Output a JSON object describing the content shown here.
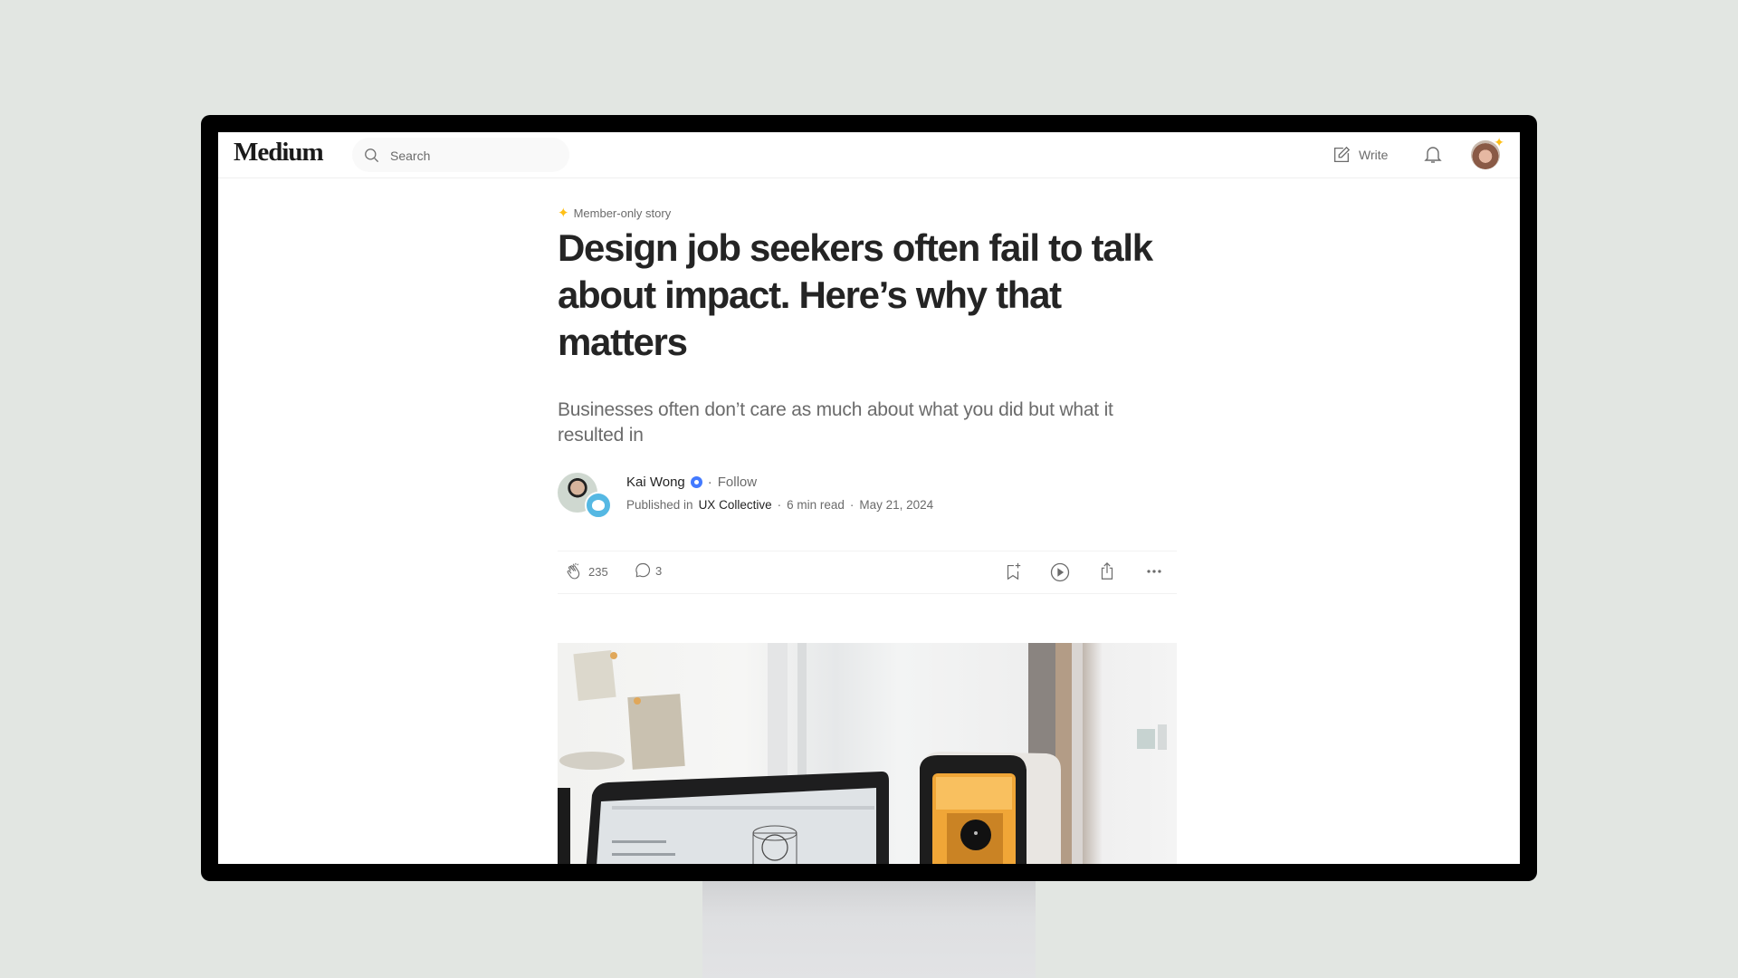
{
  "header": {
    "logo": "Medium",
    "search_placeholder": "Search",
    "write_label": "Write"
  },
  "article": {
    "badge": "Member-only story",
    "title": "Design job seekers often fail to talk about impact. Here’s why that matters",
    "subtitle": "Businesses often don’t care as much about what you did but what it resulted in",
    "author": {
      "name": "Kai Wong",
      "follow_label": "Follow",
      "published_prefix": "Published in",
      "publication": "UX Collective",
      "read_time": "6 min read",
      "date": "May 21, 2024"
    },
    "stats": {
      "claps": "235",
      "comments": "3"
    }
  },
  "colors": {
    "accent_star": "#ffc017",
    "verified_badge": "#437aff",
    "text_primary": "#242424",
    "text_secondary": "#6b6b6b"
  }
}
